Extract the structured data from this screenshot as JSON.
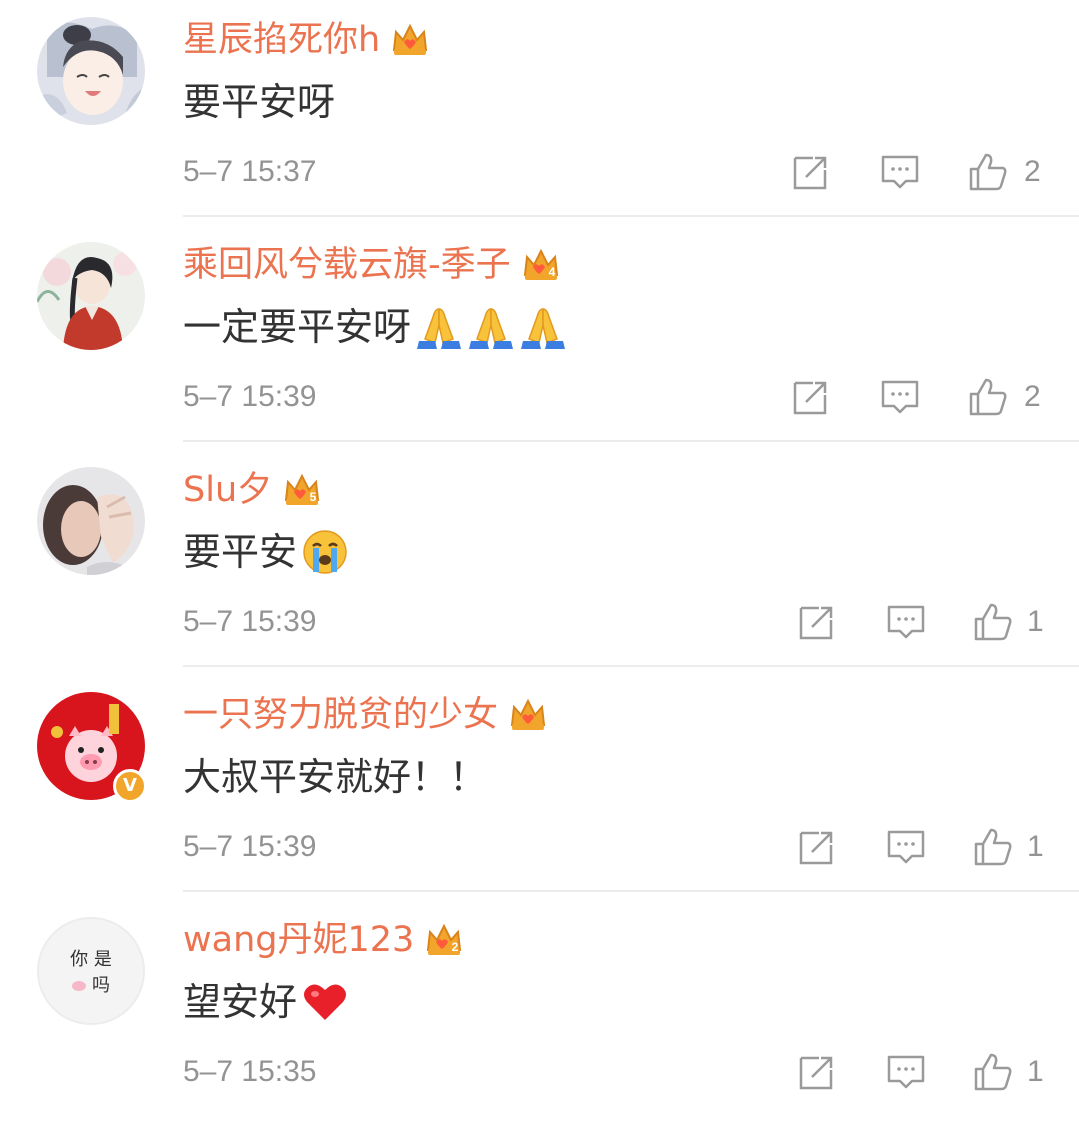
{
  "comments": [
    {
      "username": "星辰掐死你h",
      "text": "要平安呀",
      "emojis": [],
      "time": "5–7 15:37",
      "likes": "2",
      "vip_level": "",
      "verified": false,
      "avatar_text": ""
    },
    {
      "username": "乘回风兮载云旗-季子",
      "text": "一定要平安呀",
      "emojis": [
        "praying-hands",
        "praying-hands",
        "praying-hands"
      ],
      "time": "5–7 15:39",
      "likes": "2",
      "vip_level": "4",
      "verified": false,
      "avatar_text": ""
    },
    {
      "username": "Slu夕",
      "text": "要平安",
      "emojis": [
        "crying-face"
      ],
      "time": "5–7 15:39",
      "likes": "1",
      "vip_level": "5",
      "verified": false,
      "avatar_text": ""
    },
    {
      "username": "一只努力脱贫的少女",
      "text": "大叔平安就好！！",
      "emojis": [],
      "time": "5–7 15:39",
      "likes": "1",
      "vip_level": "",
      "verified": true,
      "verified_mark": "V",
      "avatar_text": ""
    },
    {
      "username": "wang丹妮123",
      "text": "望安好",
      "emojis": [
        "red-heart"
      ],
      "time": "5–7 15:35",
      "likes": "1",
      "vip_level": "2",
      "verified": false,
      "avatar_text_line1": "你 是",
      "avatar_text_line2": "吗"
    }
  ],
  "colors": {
    "username": "#eb7350",
    "body_text": "#333333",
    "meta_text": "#939393",
    "divider": "#ececec",
    "badge_gold": "#f2a52b"
  },
  "icons": {
    "repost": "repost-icon",
    "comment": "comment-icon",
    "like": "thumbs-up-icon",
    "vip": "vip-crown-icon"
  }
}
